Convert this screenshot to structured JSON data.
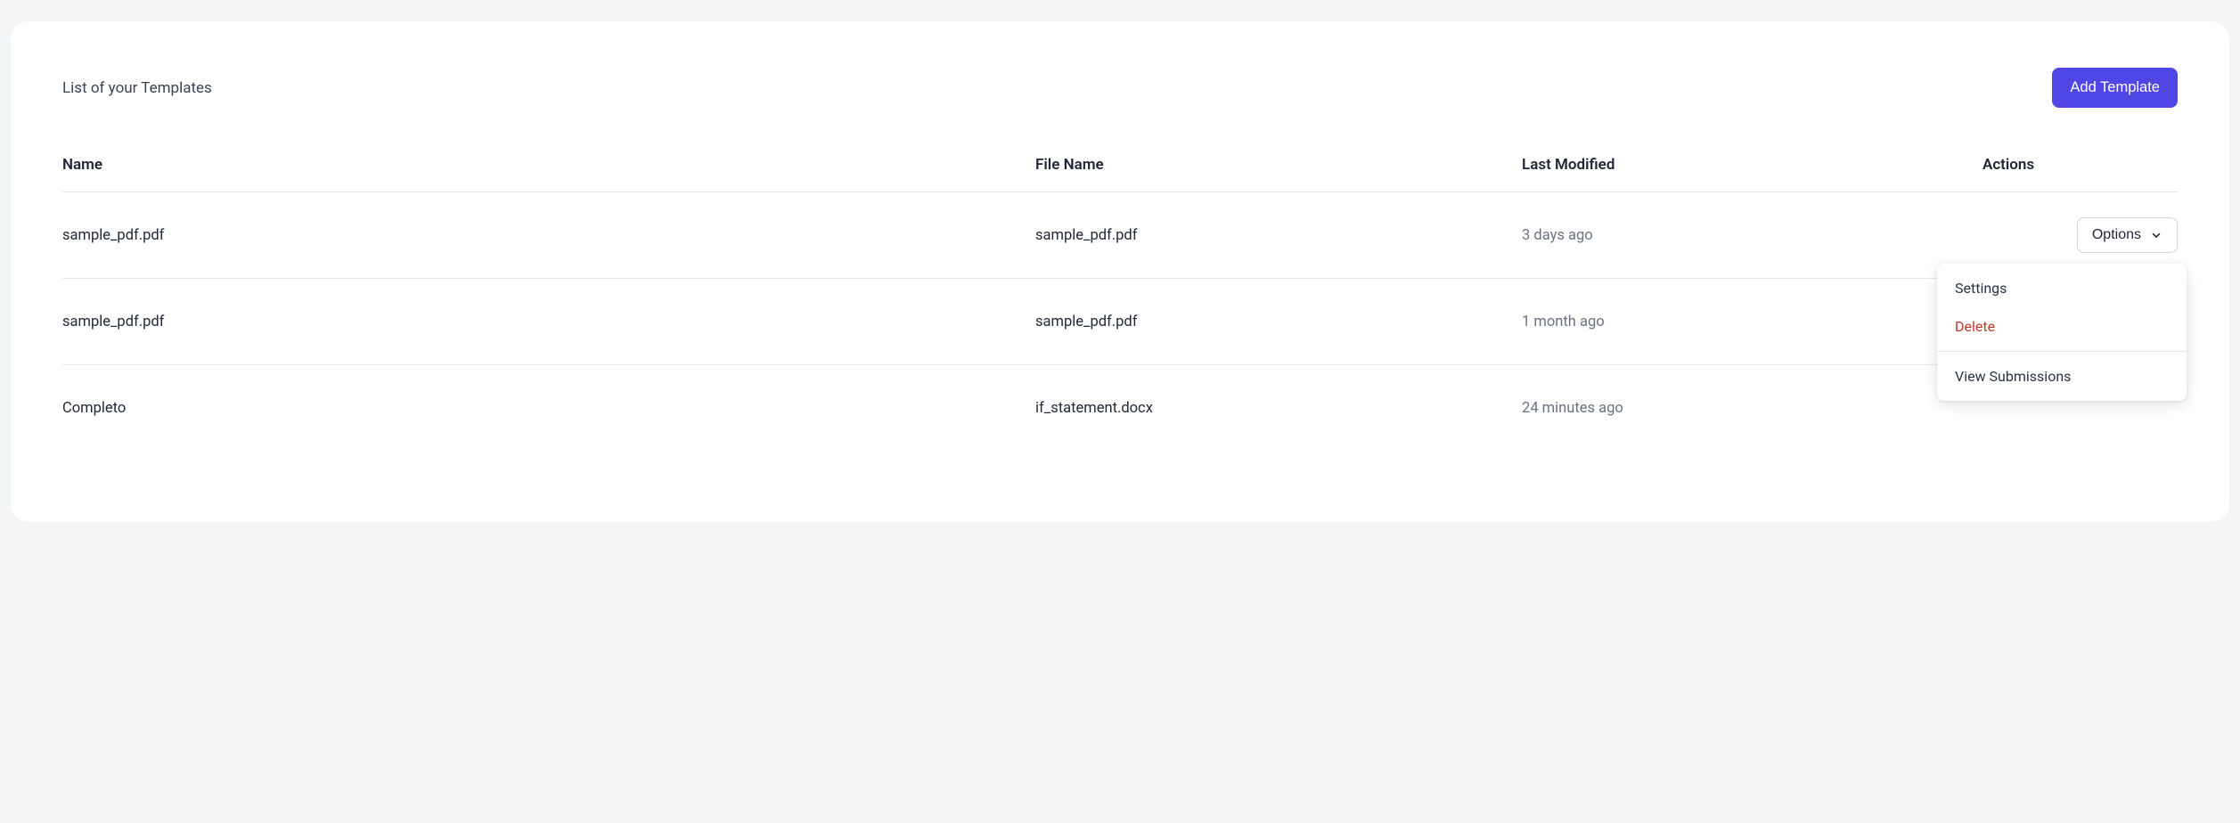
{
  "header": {
    "title": "List of your Templates",
    "add_button": "Add Template"
  },
  "columns": {
    "name": "Name",
    "file": "File Name",
    "modified": "Last Modified",
    "actions": "Actions"
  },
  "options_label": "Options",
  "rows": [
    {
      "name": "sample_pdf.pdf",
      "file": "sample_pdf.pdf",
      "modified": "3 days ago"
    },
    {
      "name": "sample_pdf.pdf",
      "file": "sample_pdf.pdf",
      "modified": "1 month ago"
    },
    {
      "name": "Completo",
      "file": "if_statement.docx",
      "modified": "24 minutes ago"
    }
  ],
  "dropdown": {
    "settings": "Settings",
    "delete": "Delete",
    "view_submissions": "View Submissions"
  }
}
